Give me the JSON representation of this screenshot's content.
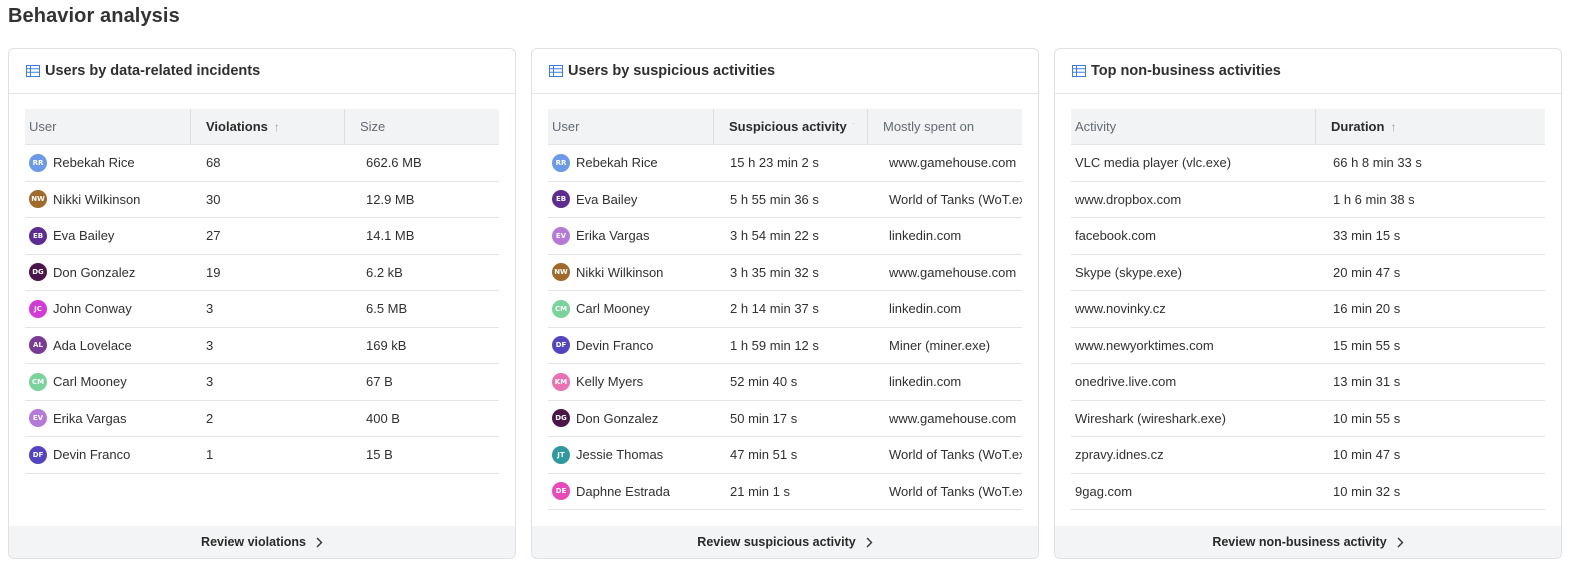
{
  "page": {
    "title": "Behavior analysis"
  },
  "colors": {
    "accent": "#3b7ddd",
    "header_bg": "#f2f3f4",
    "footer_bg": "#f3f4f5"
  },
  "cards": [
    {
      "title": "Users by data-related incidents",
      "icon": "table-icon",
      "columns": [
        "User",
        "Violations",
        "Size"
      ],
      "sorted_column": "Violations",
      "rows": [
        {
          "initials": "RR",
          "color": "#6a9ae8",
          "user": "Rebekah Rice",
          "v": "68",
          "size": "662.6 MB"
        },
        {
          "initials": "NW",
          "color": "#a06a2a",
          "user": "Nikki Wilkinson",
          "v": "30",
          "size": "12.9 MB"
        },
        {
          "initials": "EB",
          "color": "#5d2d91",
          "user": "Eva Bailey",
          "v": "27",
          "size": "14.1 MB"
        },
        {
          "initials": "DG",
          "color": "#4a1548",
          "user": "Don Gonzalez",
          "v": "19",
          "size": "6.2 kB"
        },
        {
          "initials": "JC",
          "color": "#d43ad8",
          "user": "John Conway",
          "v": "3",
          "size": "6.5 MB"
        },
        {
          "initials": "AL",
          "color": "#7a3b95",
          "user": "Ada Lovelace",
          "v": "3",
          "size": "169 kB"
        },
        {
          "initials": "CM",
          "color": "#7ad39a",
          "user": "Carl Mooney",
          "v": "3",
          "size": "67 B"
        },
        {
          "initials": "EV",
          "color": "#b57ad8",
          "user": "Erika Vargas",
          "v": "2",
          "size": "400 B"
        },
        {
          "initials": "DF",
          "color": "#5544c2",
          "user": "Devin Franco",
          "v": "1",
          "size": "15 B"
        }
      ],
      "footer": "Review violations"
    },
    {
      "title": "Users by suspicious activities",
      "icon": "table-icon",
      "columns": [
        "User",
        "Suspicious activity",
        "Mostly spent on"
      ],
      "sorted_column": "Suspicious activity",
      "rows": [
        {
          "initials": "RR",
          "color": "#6a9ae8",
          "user": "Rebekah Rice",
          "v": "15 h 23 min 2 s",
          "size": "www.gamehouse.com"
        },
        {
          "initials": "EB",
          "color": "#5d2d91",
          "user": "Eva Bailey",
          "v": "5 h 55 min 36 s",
          "size": "World of Tanks (WoT.exe)"
        },
        {
          "initials": "EV",
          "color": "#b57ad8",
          "user": "Erika Vargas",
          "v": "3 h 54 min 22 s",
          "size": "linkedin.com"
        },
        {
          "initials": "NW",
          "color": "#a06a2a",
          "user": "Nikki Wilkinson",
          "v": "3 h 35 min 32 s",
          "size": "www.gamehouse.com"
        },
        {
          "initials": "CM",
          "color": "#7ad39a",
          "user": "Carl Mooney",
          "v": "2 h 14 min 37 s",
          "size": "linkedin.com"
        },
        {
          "initials": "DF",
          "color": "#5544c2",
          "user": "Devin Franco",
          "v": "1 h 59 min 12 s",
          "size": "Miner (miner.exe)"
        },
        {
          "initials": "KM",
          "color": "#e872b2",
          "user": "Kelly Myers",
          "v": "52 min 40 s",
          "size": "linkedin.com"
        },
        {
          "initials": "DG",
          "color": "#4a1548",
          "user": "Don Gonzalez",
          "v": "50 min 17 s",
          "size": "www.gamehouse.com"
        },
        {
          "initials": "JT",
          "color": "#2e9aa0",
          "user": "Jessie Thomas",
          "v": "47 min 51 s",
          "size": "World of Tanks (WoT.exe)"
        },
        {
          "initials": "DE",
          "color": "#e84bb8",
          "user": "Daphne Estrada",
          "v": "21 min 1 s",
          "size": "World of Tanks (WoT.exe)"
        }
      ],
      "footer": "Review suspicious activity"
    },
    {
      "title": "Top non-business activities",
      "icon": "table-icon",
      "columns": [
        "Activity",
        "Duration"
      ],
      "sorted_column": "Duration",
      "rows": [
        {
          "activity": "VLC media player (vlc.exe)",
          "duration": "66 h 8 min 33 s"
        },
        {
          "activity": "www.dropbox.com",
          "duration": "1 h 6 min 38 s"
        },
        {
          "activity": "facebook.com",
          "duration": "33 min 15 s"
        },
        {
          "activity": "Skype (skype.exe)",
          "duration": "20 min 47 s"
        },
        {
          "activity": "www.novinky.cz",
          "duration": "16 min 20 s"
        },
        {
          "activity": "www.newyorktimes.com",
          "duration": "15 min 55 s"
        },
        {
          "activity": "onedrive.live.com",
          "duration": "13 min 31 s"
        },
        {
          "activity": "Wireshark (wireshark.exe)",
          "duration": "10 min 55 s"
        },
        {
          "activity": "zpravy.idnes.cz",
          "duration": "10 min 47 s"
        },
        {
          "activity": "9gag.com",
          "duration": "10 min 32 s"
        }
      ],
      "footer": "Review non-business activity"
    }
  ]
}
